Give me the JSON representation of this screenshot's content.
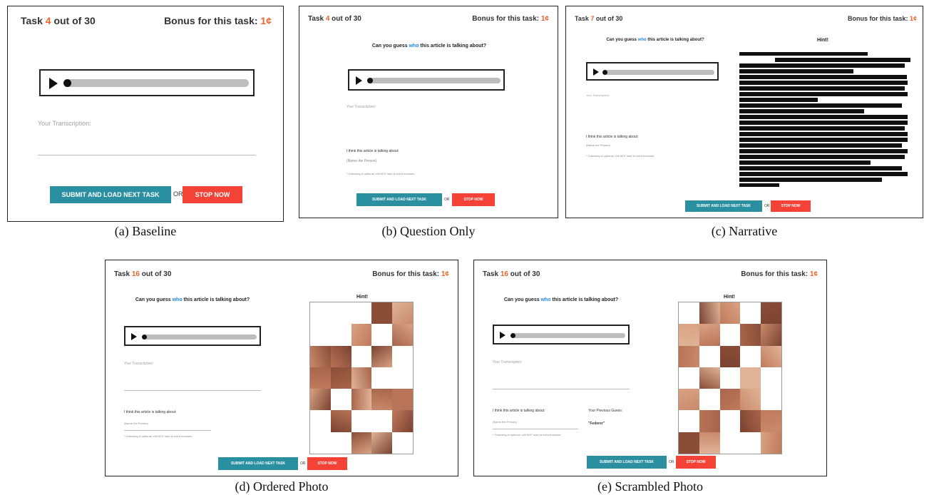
{
  "panels": {
    "a": {
      "task_prefix": "Task ",
      "task_num": "4",
      "task_suffix": " out of 30",
      "bonus_label": "Bonus for this task:",
      "bonus_value": "1¢",
      "transcription_label": "Your Transcription:",
      "submit_label": "SUBMIT AND LOAD NEXT TASK",
      "or_label": "OR",
      "stop_label": "STOP NOW",
      "caption": "(a) Baseline"
    },
    "b": {
      "task_prefix": "Task ",
      "task_num": "4",
      "task_suffix": " out of 30",
      "bonus_label": "Bonus for this task:",
      "bonus_value": "1¢",
      "question_pre": "Can you guess ",
      "question_who": "who",
      "question_post": " this article is talking about?",
      "transcription_label": "Your Transcription:",
      "guess_label": "I think this article is talking about:",
      "guess_placeholder": "(Name the Person)",
      "guess_note": "* Guessing is optional, will NOT lead to extra bonuses.",
      "submit_label": "SUBMIT AND LOAD NEXT TASK",
      "or_label": "OR",
      "stop_label": "STOP NOW",
      "caption": "(b) Question Only"
    },
    "c": {
      "task_prefix": "Task ",
      "task_num": "7",
      "task_suffix": " out of 30",
      "bonus_label": "Bonus for this task:",
      "bonus_value": "1¢",
      "question_pre": "Can you guess ",
      "question_who": "who",
      "question_post": " this article is talking about?",
      "hint_title": "Hint!",
      "transcription_label": "Your Transcription:",
      "guess_label": "I think this article is talking about:",
      "guess_placeholder": "(Name the Person)",
      "guess_note": "* Guessing is optional, will NOT lead to extra bonuses.",
      "submit_label": "SUBMIT AND LOAD NEXT TASK",
      "or_label": "OR",
      "stop_label": "STOP NOW",
      "caption": "(c) Narrative"
    },
    "d": {
      "task_prefix": "Task ",
      "task_num": "16",
      "task_suffix": " out of 30",
      "bonus_label": "Bonus for this task:",
      "bonus_value": "1¢",
      "question_pre": "Can you guess ",
      "question_who": "who",
      "question_post": " this article is talking about?",
      "hint_title": "Hint!",
      "transcription_label": "Your Transcription:",
      "guess_label": "I think this article is talking about:",
      "guess_placeholder": "(Name the Person)",
      "guess_note": "* Guessing is optional, will NOT lead to extra bonuses.",
      "submit_label": "SUBMIT AND LOAD NEXT TASK",
      "or_label": "OR",
      "stop_label": "STOP NOW",
      "caption": "(d) Ordered Photo"
    },
    "e": {
      "task_prefix": "Task ",
      "task_num": "16",
      "task_suffix": " out of 30",
      "bonus_label": "Bonus for this task:",
      "bonus_value": "1¢",
      "question_pre": "Can you guess ",
      "question_who": "who",
      "question_post": " this article is talking about?",
      "hint_title": "Hint!",
      "transcription_label": "Your Transcription:",
      "guess_label": "I think this article is talking about:",
      "guess_placeholder": "(Name the Person)",
      "guess_note": "* Guessing is optional, will NOT lead to extra bonuses.",
      "previous_guess_label": "Your Previous Guess:",
      "previous_guess_value": "\"Federer\"",
      "submit_label": "SUBMIT AND LOAD NEXT TASK",
      "or_label": "OR",
      "stop_label": "STOP NOW",
      "caption": "(e) Scrambled Photo"
    }
  },
  "icons": {
    "play": "play-icon",
    "scrubber": "scrubber-knob"
  },
  "colors": {
    "accent": "#e8632b",
    "who": "#1e88e5",
    "submit": "#2a8fa0",
    "stop": "#f44336"
  }
}
